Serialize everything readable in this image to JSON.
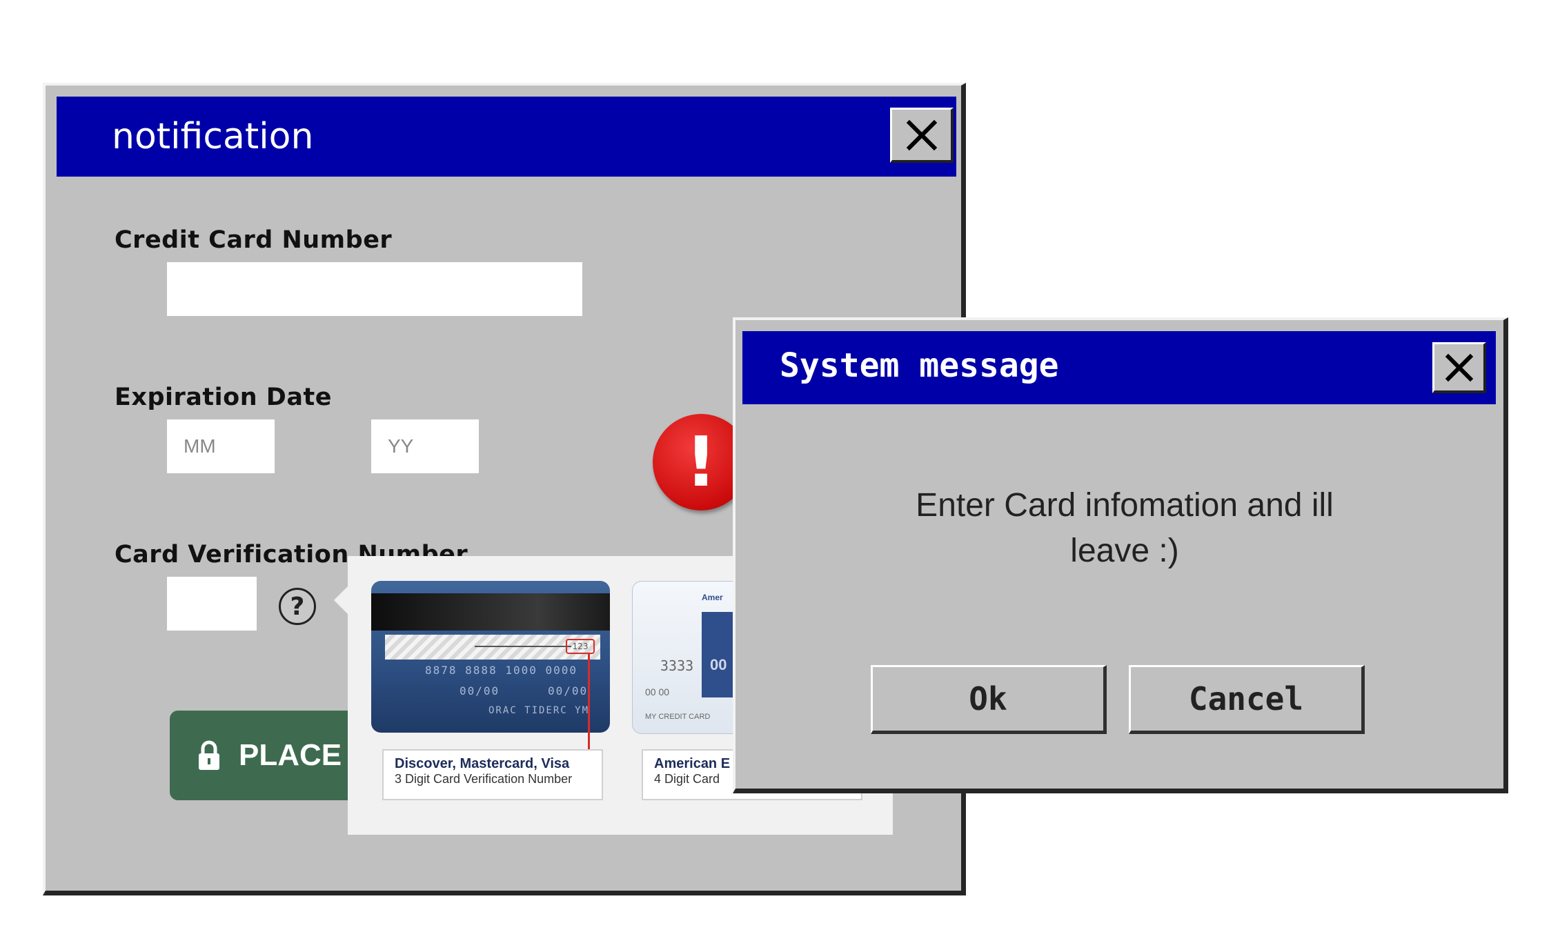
{
  "notification": {
    "title": "notification",
    "close_icon": "close-icon",
    "fields": {
      "card_number_label": "Credit Card Number",
      "card_number_value": "",
      "expiration_label": "Expiration Date",
      "month_placeholder": "MM",
      "year_placeholder": "YY",
      "cvv_label": "Card Verification Number",
      "cvv_value": "",
      "help_icon": "question-circle-icon",
      "help_glyph": "?"
    },
    "place_button": {
      "icon": "lock-icon",
      "label": "PLACE"
    }
  },
  "cvv_tooltip": {
    "visa_card": {
      "cvv_digits": "123",
      "numbers_line": "8878 8888 1000 0000",
      "date_line": "00/00      00/00",
      "name_line": "ORAC TIDERC YM",
      "label_line1": "Discover, Mastercard, Visa",
      "label_line2": "3 Digit Card Verification Number"
    },
    "amex_card": {
      "brand_text": "Amer",
      "number_text": "3333",
      "badge_text": "00",
      "date_text": "00 00",
      "name_text": "MY CREDIT CARD",
      "label_line1": "American E",
      "label_line2": "4 Digit Card"
    }
  },
  "alert_badge": {
    "icon": "exclamation-icon",
    "glyph": "!"
  },
  "system_message": {
    "title": "System message",
    "close_icon": "close-icon",
    "message_line1": "Enter Card infomation and ill",
    "message_line2": "leave :)",
    "ok_label": "Ok",
    "cancel_label": "Cancel"
  },
  "colors": {
    "titlebar": "#0000a8",
    "window_bg": "#c0c0c0",
    "place_button": "#3e6b4f",
    "alert_red": "#cc0c0c"
  }
}
